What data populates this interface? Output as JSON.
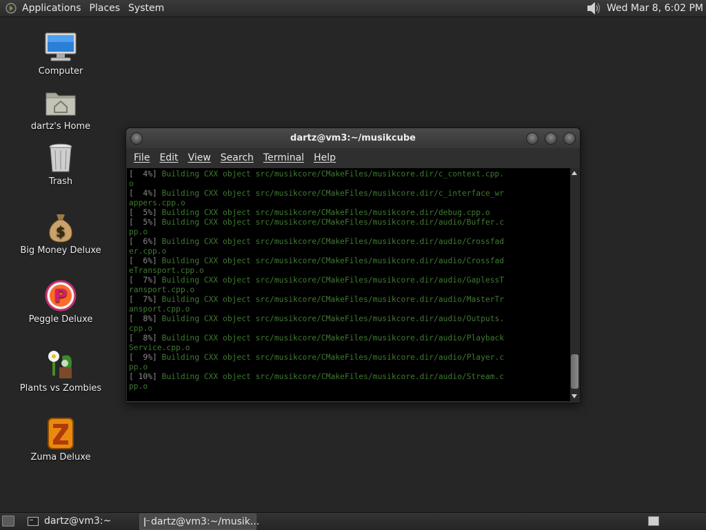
{
  "top_panel": {
    "menus": [
      "Applications",
      "Places",
      "System"
    ],
    "clock": "Wed Mar  8,  6:02 PM",
    "volume_icon": "speaker-icon"
  },
  "desktop": {
    "icons": [
      {
        "label": "Computer",
        "icon": "computer-icon"
      },
      {
        "label": "dartz's Home",
        "icon": "home-folder-icon"
      },
      {
        "label": "Trash",
        "icon": "trash-icon"
      },
      {
        "label": "Big Money Deluxe",
        "icon": "money-bag-icon"
      },
      {
        "label": "Peggle Deluxe",
        "icon": "peggle-icon"
      },
      {
        "label": "Plants vs Zombies",
        "icon": "plants-vs-zombies-icon"
      },
      {
        "label": "Zuma Deluxe",
        "icon": "zuma-icon"
      }
    ]
  },
  "terminal": {
    "title": "dartz@vm3:~/musikcube",
    "menu": [
      "File",
      "Edit",
      "View",
      "Search",
      "Terminal",
      "Help"
    ],
    "lines": [
      [
        "[  4%] ",
        "Building CXX object src/musikcore/CMakeFiles/musikcore.dir/c_context.cpp."
      ],
      [
        "",
        "o"
      ],
      [
        "[  4%] ",
        "Building CXX object src/musikcore/CMakeFiles/musikcore.dir/c_interface_wr"
      ],
      [
        "",
        "appers.cpp.o"
      ],
      [
        "[  5%] ",
        "Building CXX object src/musikcore/CMakeFiles/musikcore.dir/debug.cpp.o"
      ],
      [
        "[  5%] ",
        "Building CXX object src/musikcore/CMakeFiles/musikcore.dir/audio/Buffer.c"
      ],
      [
        "",
        "pp.o"
      ],
      [
        "[  6%] ",
        "Building CXX object src/musikcore/CMakeFiles/musikcore.dir/audio/Crossfad"
      ],
      [
        "",
        "er.cpp.o"
      ],
      [
        "[  6%] ",
        "Building CXX object src/musikcore/CMakeFiles/musikcore.dir/audio/Crossfad"
      ],
      [
        "",
        "eTransport.cpp.o"
      ],
      [
        "[  7%] ",
        "Building CXX object src/musikcore/CMakeFiles/musikcore.dir/audio/GaplessT"
      ],
      [
        "",
        "ransport.cpp.o"
      ],
      [
        "[  7%] ",
        "Building CXX object src/musikcore/CMakeFiles/musikcore.dir/audio/MasterTr"
      ],
      [
        "",
        "ansport.cpp.o"
      ],
      [
        "[  8%] ",
        "Building CXX object src/musikcore/CMakeFiles/musikcore.dir/audio/Outputs."
      ],
      [
        "",
        "cpp.o"
      ],
      [
        "[  8%] ",
        "Building CXX object src/musikcore/CMakeFiles/musikcore.dir/audio/Playback"
      ],
      [
        "",
        "Service.cpp.o"
      ],
      [
        "[  9%] ",
        "Building CXX object src/musikcore/CMakeFiles/musikcore.dir/audio/Player.c"
      ],
      [
        "",
        "pp.o"
      ],
      [
        "[ 10%] ",
        "Building CXX object src/musikcore/CMakeFiles/musikcore.dir/audio/Stream.c"
      ],
      [
        "",
        "pp.o"
      ]
    ]
  },
  "taskbar": {
    "tasks": [
      {
        "label": "dartz@vm3:~",
        "active": false
      },
      {
        "label": "dartz@vm3:~/musik...",
        "active": true
      }
    ]
  }
}
